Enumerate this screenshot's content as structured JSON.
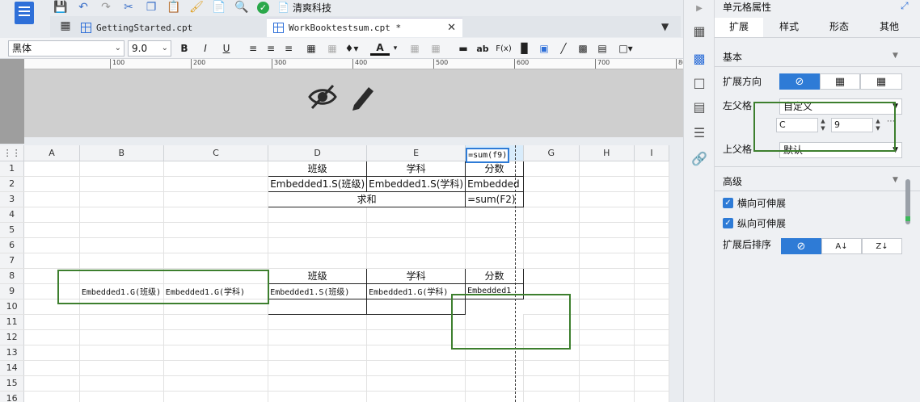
{
  "toolbar": {
    "brand_label": "清爽科技"
  },
  "tabs": [
    {
      "label": "GettingStarted.cpt"
    },
    {
      "label": "WorkBooktestsum.cpt *"
    }
  ],
  "format": {
    "font_family": "黑体",
    "font_size": "9.0",
    "bold": "B",
    "italic": "I",
    "underline": "U",
    "text_tool": "ab",
    "formula_tool": "F(x)"
  },
  "ruler_ticks": [
    "100",
    "200",
    "300",
    "400",
    "500",
    "600",
    "700",
    "800"
  ],
  "grid": {
    "columns": [
      "A",
      "B",
      "C",
      "D",
      "E",
      "F",
      "G",
      "H",
      "I"
    ],
    "rows": [
      "1",
      "2",
      "3",
      "4",
      "5",
      "6",
      "7",
      "8",
      "9",
      "10",
      "11",
      "12",
      "13",
      "14",
      "15",
      "16"
    ],
    "cells": {
      "D1": "班级",
      "E1": "学科",
      "F1": "分数",
      "D2": "Embedded1.S(班级)",
      "E2": "Embedded1.S(学科)",
      "F2": "Embedded",
      "D3": "求和",
      "F3": "=sum(F2)",
      "D8": "班级",
      "E8": "学科",
      "F8": "分数",
      "B9": "Embedded1.G(班级)",
      "C9": "Embedded1.G(学科)",
      "D9": "Embedded1.S(班级)",
      "E9": "Embedded1.G(学科)",
      "F9": "Embedded1",
      "F10": "=sum(f9)"
    }
  },
  "panel": {
    "title": "单元格属性",
    "tabs": [
      "扩展",
      "样式",
      "形态",
      "其他"
    ],
    "section_basic": "基本",
    "expand_direction_label": "扩展方向",
    "left_parent_label": "左父格",
    "left_parent_value": "自定义",
    "left_parent_col": "C",
    "left_parent_row": "9",
    "top_parent_label": "上父格",
    "top_parent_value": "默认",
    "section_advanced": "高级",
    "horizontal_extend_label": "横向可伸展",
    "vertical_extend_label": "纵向可伸展",
    "sort_after_expand_label": "扩展后排序",
    "sort_asc_label": "A↓",
    "sort_desc_label": "Z↓"
  },
  "colors": {
    "accent": "#2e7bd6",
    "highlight_box": "#3d7f2e",
    "check_green": "#2aa84a"
  }
}
